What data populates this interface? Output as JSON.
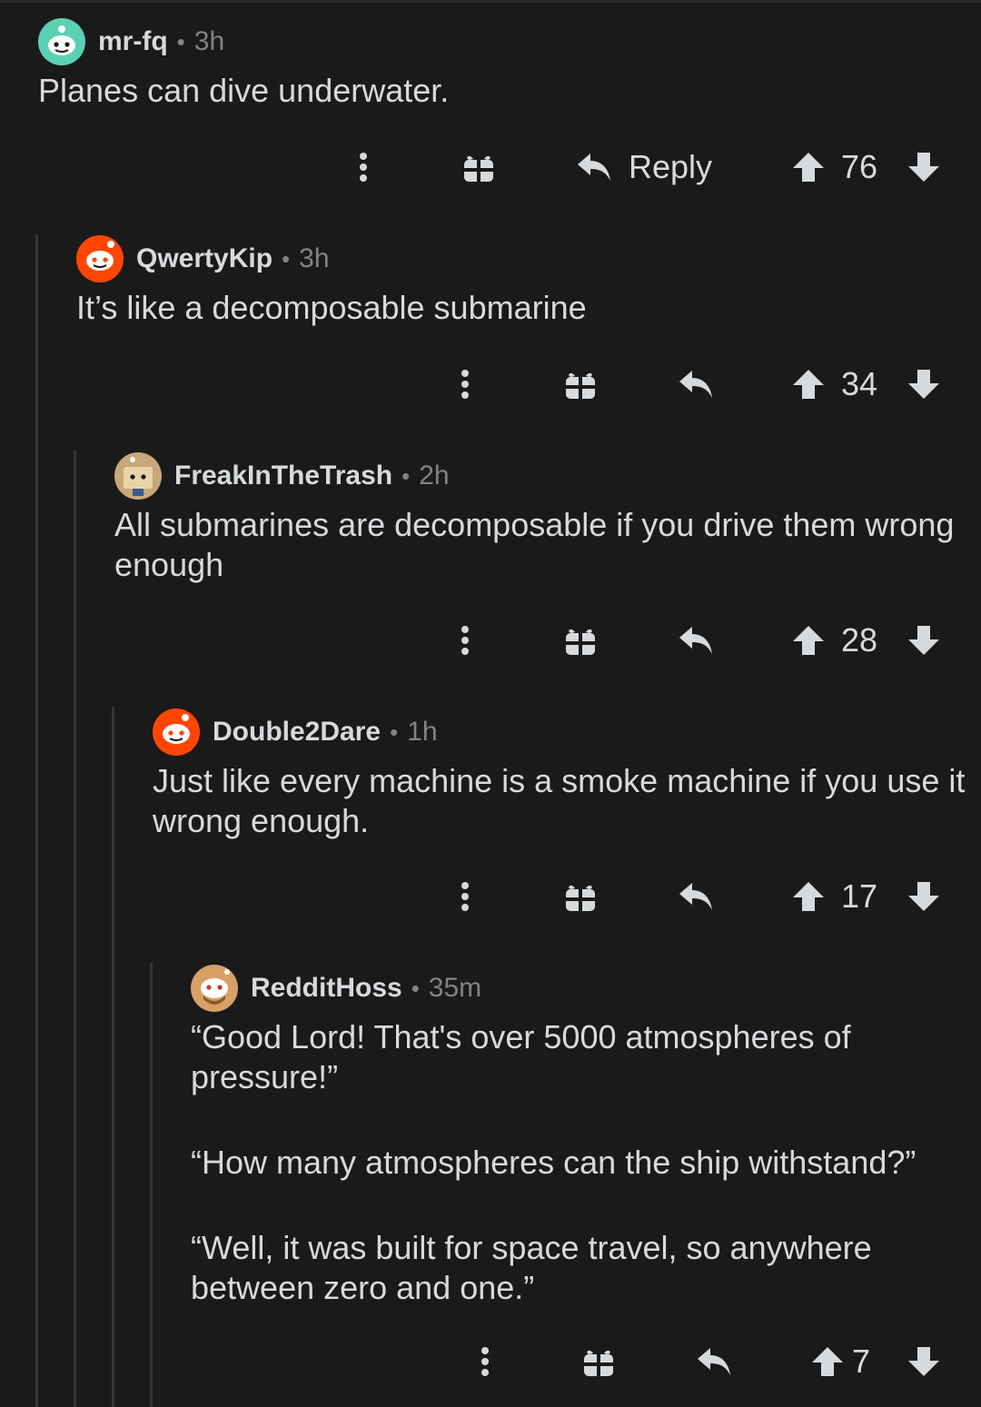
{
  "comments": [
    {
      "username": "mr-fq",
      "time": "3h",
      "body": [
        "Planes can dive underwater."
      ],
      "reply_label": "Reply",
      "score": "76",
      "avatar": {
        "bg": "#5bd1b3",
        "accent": "#1a1a1b",
        "icon": "snoo-avatar-icon"
      }
    },
    {
      "username": "QwertyKip",
      "time": "3h",
      "body": [
        "It’s like a decomposable submarine"
      ],
      "reply_label": "",
      "score": "34",
      "avatar": {
        "bg": "#ff4500",
        "accent": "#ffffff",
        "icon": "snoo-avatar-icon"
      }
    },
    {
      "username": "FreakInTheTrash",
      "time": "2h",
      "body": [
        "All submarines are decomposable if you drive them wrong enough"
      ],
      "reply_label": "",
      "score": "28",
      "avatar": {
        "bg": "#c8a878",
        "accent": "#1a1a1b",
        "icon": "snoo-avatar-icon"
      }
    },
    {
      "username": "Double2Dare",
      "time": "1h",
      "body": [
        "Just like every machine is a smoke machine if you use it wrong enough."
      ],
      "reply_label": "",
      "score": "17",
      "avatar": {
        "bg": "#ff4500",
        "accent": "#ffffff",
        "icon": "snoo-avatar-icon"
      }
    },
    {
      "username": "RedditHoss",
      "time": "35m",
      "body": [
        "“Good Lord! That's over 5000 atmospheres of pressure!”",
        "“How many atmospheres can the ship withstand?”",
        "“Well, it was built for space travel, so anywhere between zero and one.”"
      ],
      "reply_label": "",
      "score": "7",
      "avatar": {
        "bg": "#d9a066",
        "accent": "#1a1a1b",
        "icon": "snoo-avatar-icon"
      }
    }
  ],
  "icons": {
    "more": "more-options-icon",
    "award": "gift-award-icon",
    "reply": "reply-arrow-icon",
    "upvote": "upvote-arrow-icon",
    "downvote": "downvote-arrow-icon"
  },
  "colors": {
    "background": "#1a1a1b",
    "text": "#d7dadc",
    "meta": "#818384",
    "thread_line": "#343536"
  }
}
